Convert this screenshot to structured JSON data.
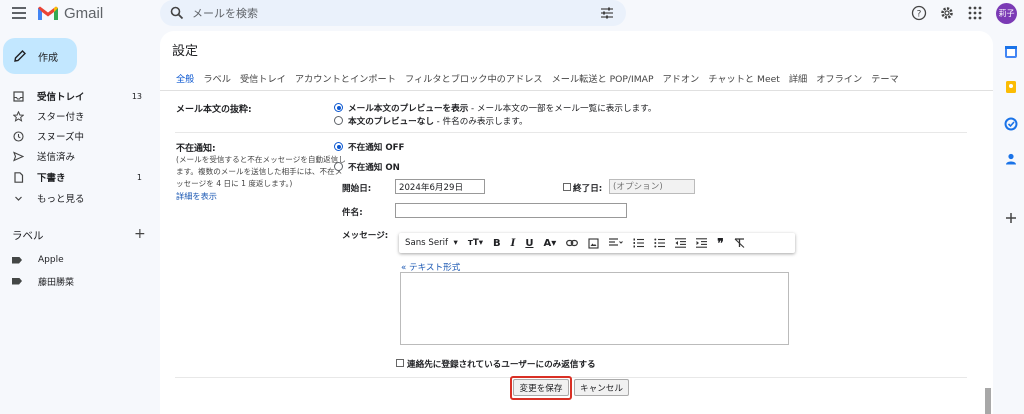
{
  "header": {
    "app_name": "Gmail",
    "search_placeholder": "メールを検索",
    "avatar_text": "莉子"
  },
  "sidebar": {
    "compose_label": "作成",
    "items": [
      {
        "label": "受信トレイ",
        "count": "13"
      },
      {
        "label": "スター付き",
        "count": ""
      },
      {
        "label": "スヌーズ中",
        "count": ""
      },
      {
        "label": "送信済み",
        "count": ""
      },
      {
        "label": "下書き",
        "count": "1"
      },
      {
        "label": "もっと見る",
        "count": ""
      }
    ],
    "labels_title": "ラベル",
    "labels_add": "+",
    "labels": [
      "Apple",
      "藤田勝菜"
    ]
  },
  "settings": {
    "title": "設定",
    "tabs": [
      "全般",
      "ラベル",
      "受信トレイ",
      "アカウントとインポート",
      "フィルタとブロック中のアドレス",
      "メール転送と POP/IMAP",
      "アドオン",
      "チャットと Meet",
      "詳細",
      "オフライン",
      "テーマ"
    ],
    "preview": {
      "label": "メール本文の抜粋:",
      "option_on_bold": "メール本文のプレビューを表示",
      "option_on_rest": " - メール本文の一部をメール一覧に表示します。",
      "option_off_bold": "本文のプレビューなし",
      "option_off_rest": " - 件名のみ表示します。"
    },
    "vacation": {
      "label": "不在通知:",
      "description": "(メールを受信すると不在メッセージを自動返信します。複数のメールを送信した相手には、不在メッセージを 4 日に 1 度返します。)",
      "details_link": "詳細を表示",
      "off_label": "不在通知 OFF",
      "on_label": "不在通知 ON",
      "start_label": "開始日:",
      "start_value": "2024年6月29日",
      "end_label": "終了日:",
      "end_placeholder": "(オプション)",
      "subject_label": "件名:",
      "subject_value": "",
      "message_label": "メッセージ:",
      "font_name": "Sans Serif",
      "rich_text_link": "« テキスト形式",
      "contacts_only_label": "連絡先に登録されているユーザーにのみ返信する"
    },
    "buttons": {
      "save": "変更を保存",
      "cancel": "キャンセル"
    }
  },
  "colors": {
    "accent": "#0b57d0",
    "compose_bg": "#c2e7ff",
    "highlight": "#d93025",
    "avatar_bg": "#7b3ab5"
  }
}
